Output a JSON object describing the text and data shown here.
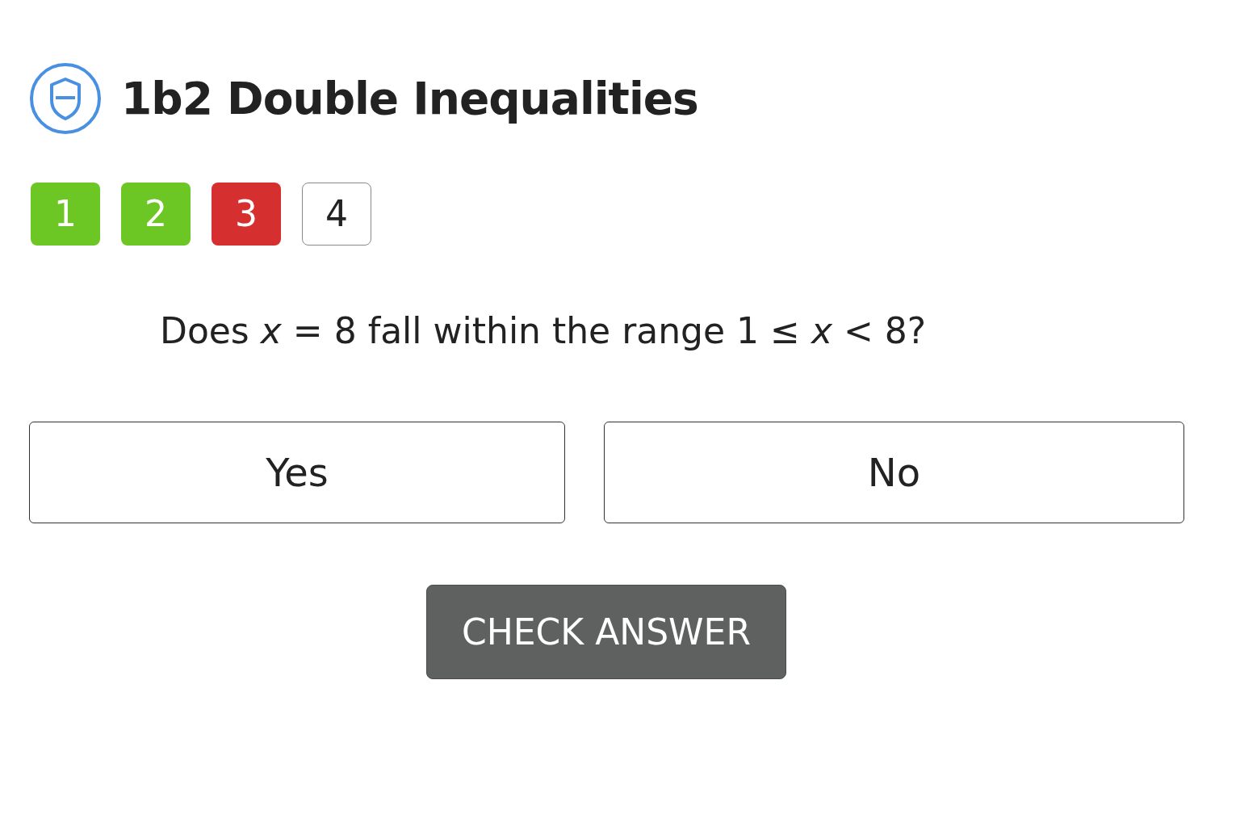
{
  "title": "1b2 Double Inequalities",
  "progress": [
    {
      "label": "1",
      "color": "#6cc624"
    },
    {
      "label": "2",
      "color": "#6cc624"
    },
    {
      "label": "3",
      "color": "#d5302f"
    },
    {
      "label": "4",
      "color": "#ffffff"
    }
  ],
  "question": "Does *x* = 8 fall within the range 1 ≤ *x* < 8?",
  "options": [
    "Yes",
    "No"
  ],
  "check_button": "CHECK ANSWER"
}
